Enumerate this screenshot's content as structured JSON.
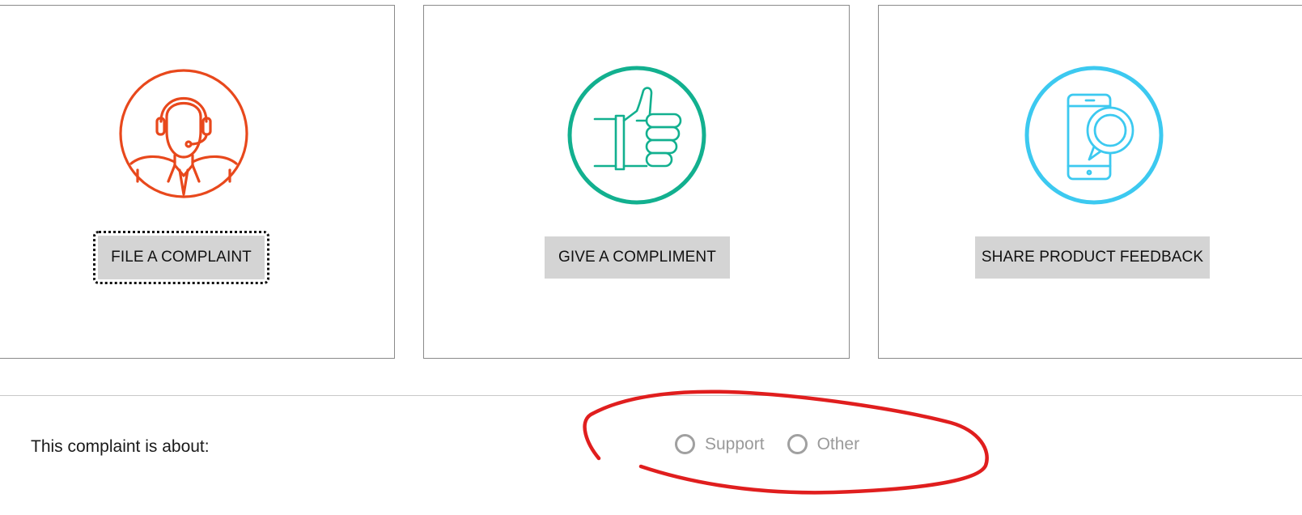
{
  "cards": [
    {
      "icon": "customer-support-agent-icon",
      "icon_color": "#e8481c",
      "button_label": "FILE A COMPLAINT",
      "focused": true
    },
    {
      "icon": "thumbs-up-icon",
      "icon_color": "#12b08f",
      "button_label": "GIVE A COMPLIMENT",
      "focused": false
    },
    {
      "icon": "phone-chat-search-icon",
      "icon_color": "#3cc9f0",
      "button_label": "SHARE PRODUCT FEEDBACK",
      "focused": false
    }
  ],
  "complaint_form": {
    "question_label": "This complaint is about:",
    "options": [
      {
        "label": "Support",
        "selected": false
      },
      {
        "label": "Other",
        "selected": false
      }
    ]
  },
  "annotation": {
    "type": "hand-drawn-circle",
    "color": "#e01e1e"
  }
}
